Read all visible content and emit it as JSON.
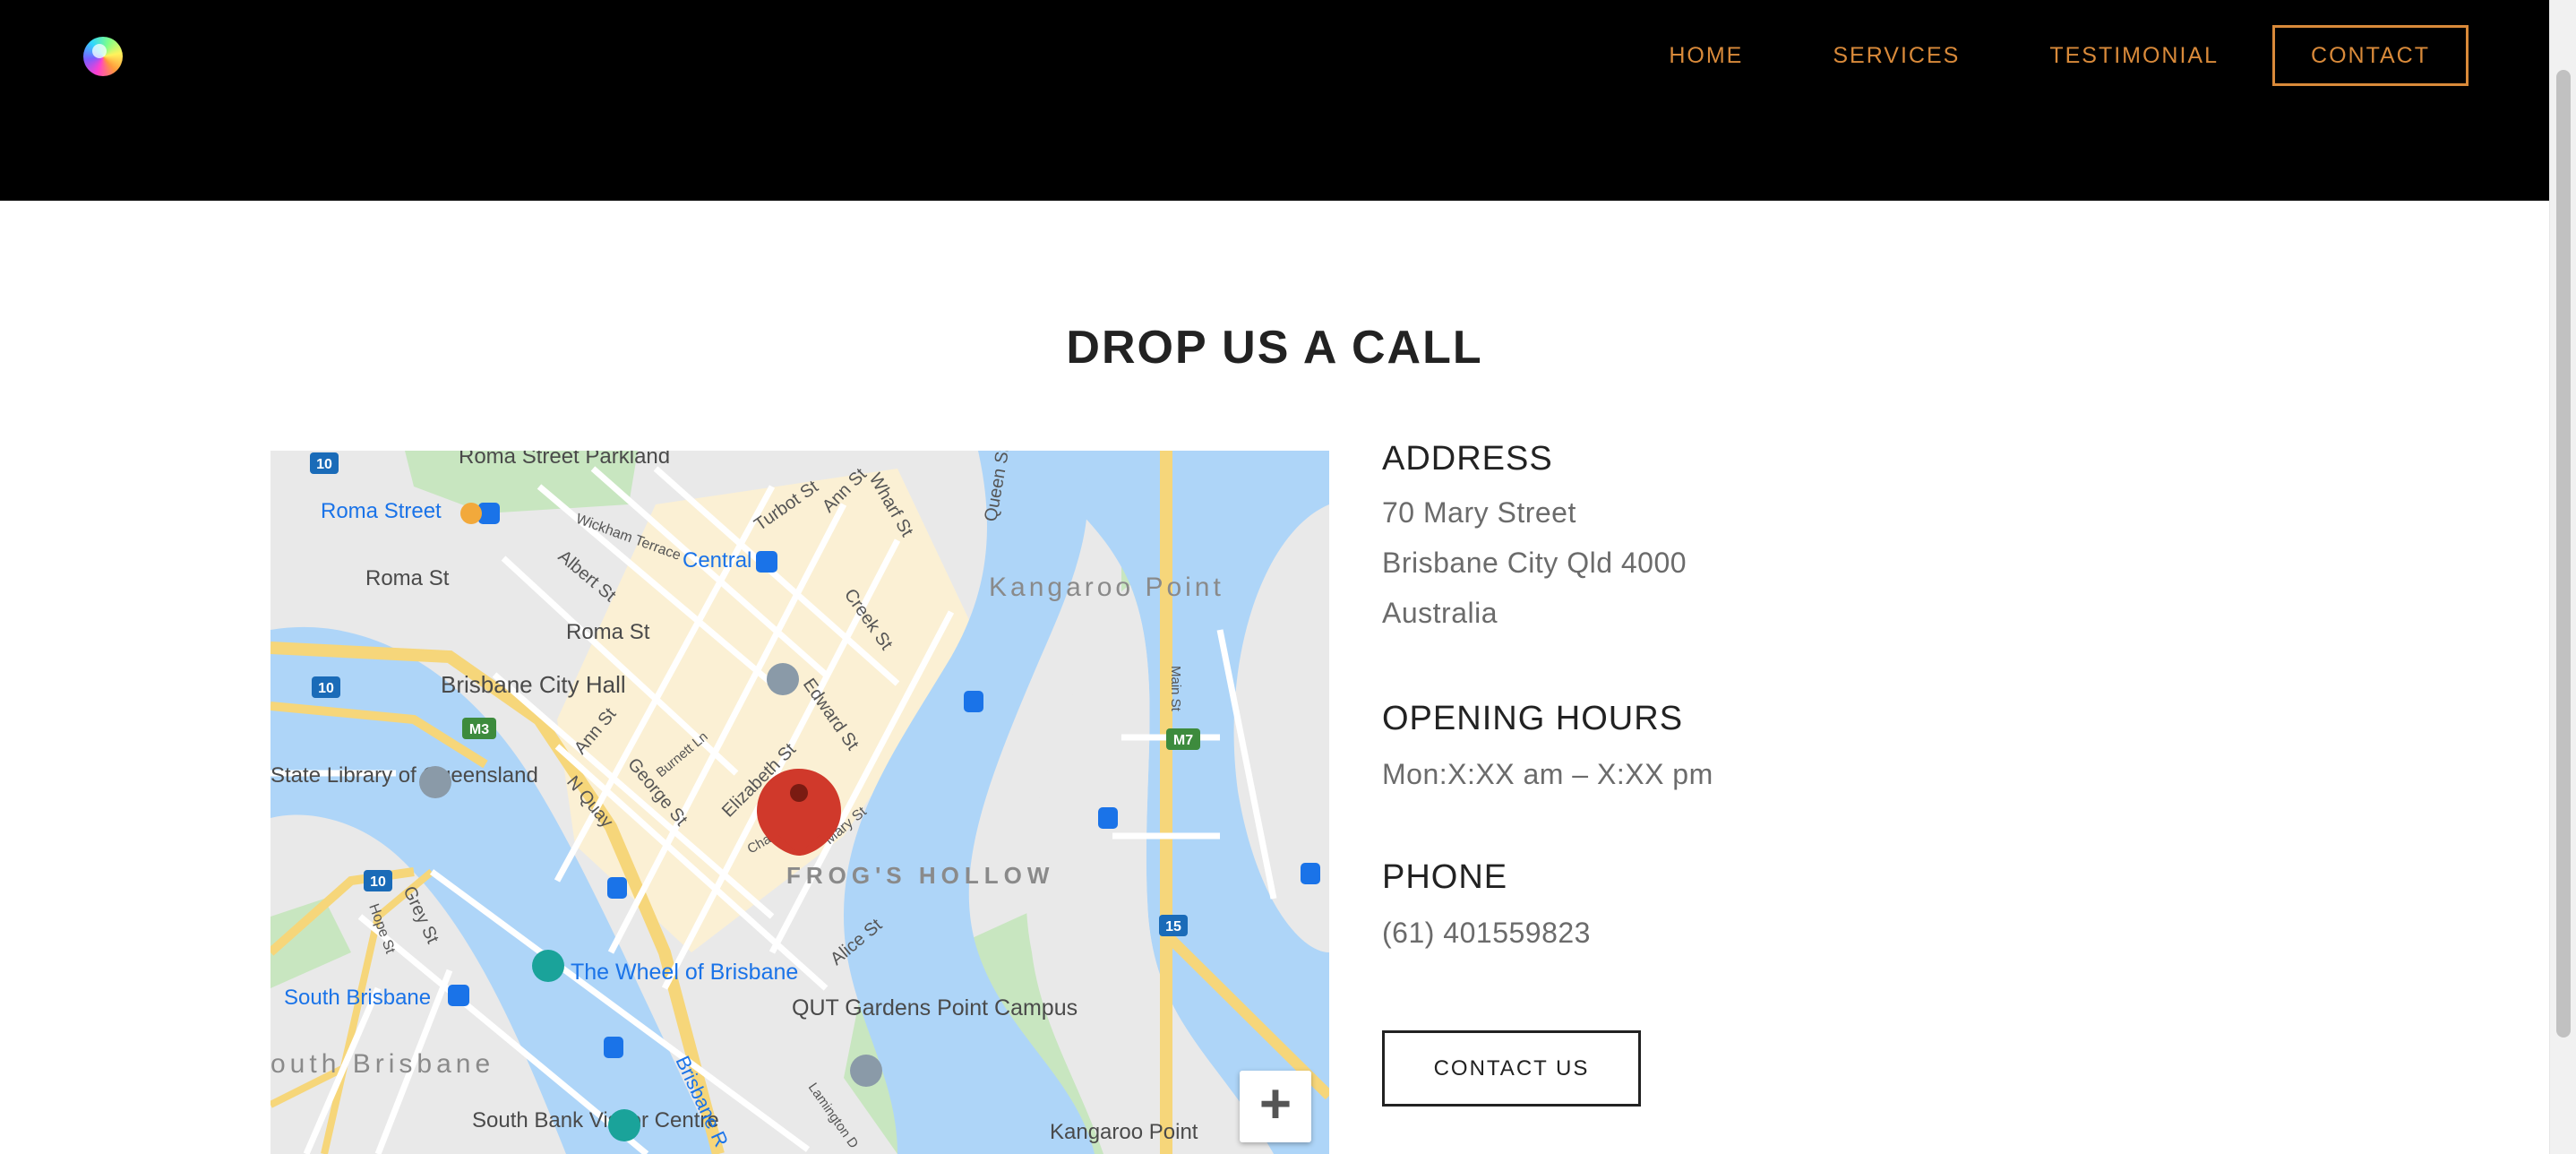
{
  "header": {
    "nav": {
      "home": "HOME",
      "services": "SERVICES",
      "testimonial": "TESTIMONIAL",
      "contact": "CONTACT"
    }
  },
  "main": {
    "title": "DROP US A CALL",
    "address": {
      "heading": "ADDRESS",
      "line1": "70 Mary Street",
      "line2": "Brisbane City Qld 4000",
      "line3": "Australia"
    },
    "hours": {
      "heading": "OPENING HOURS",
      "text": "Mon:X:XX am – X:XX pm"
    },
    "phone": {
      "heading": "PHONE",
      "number": "(61) 401559823"
    },
    "contact_button": "CONTACT US"
  },
  "map": {
    "zoom_in": "+",
    "labels": {
      "roma_street_parkland": "Roma Street Parkland",
      "roma_street_station": "Roma Street",
      "roma_st": "Roma St",
      "roma_st_2": "Roma St",
      "albert_st": "Albert St",
      "wickham_terrace": "Wickham Terrace",
      "turbot_st": "Turbot St",
      "ann_st": "Ann St",
      "wharf_st": "Wharf St",
      "queen_st": "Queen St",
      "central": "Central",
      "creek_st": "Creek St",
      "kangaroo_point": "Kangaroo Point",
      "brisbane_city_hall": "Brisbane City Hall",
      "edward_st": "Edward St",
      "ann_st_2": "Ann St",
      "burnett_ln": "Burnett Ln",
      "george_st": "George St",
      "elizabeth_st": "Elizabeth St",
      "state_library": "State Library of Queensland",
      "n_quay": "N Quay",
      "frogs_hollow": "FROG'S HOLLOW",
      "charlotte": "Charlo",
      "mary_st": "Mary St",
      "alice_st": "Alice St",
      "grey_st": "Grey St",
      "hope_st": "Hope St",
      "wheel_of_brisbane": "The Wheel of Brisbane",
      "qut": "QUT Gardens Point Campus",
      "south_brisbane_station": "South Brisbane",
      "south_brisbane_area": "outh Brisbane",
      "south_bank_visitor": "South Bank Visitor Centre",
      "brisbane_river": "Brisbane R",
      "lamington": "Lamington D",
      "kangaroo_point_bottom": "Kangaroo Point",
      "main_st": "Main St",
      "shield_10a": "10",
      "shield_10b": "10",
      "shield_10c": "10",
      "shield_m3": "M3",
      "shield_m7": "M7",
      "shield_15": "15"
    }
  }
}
